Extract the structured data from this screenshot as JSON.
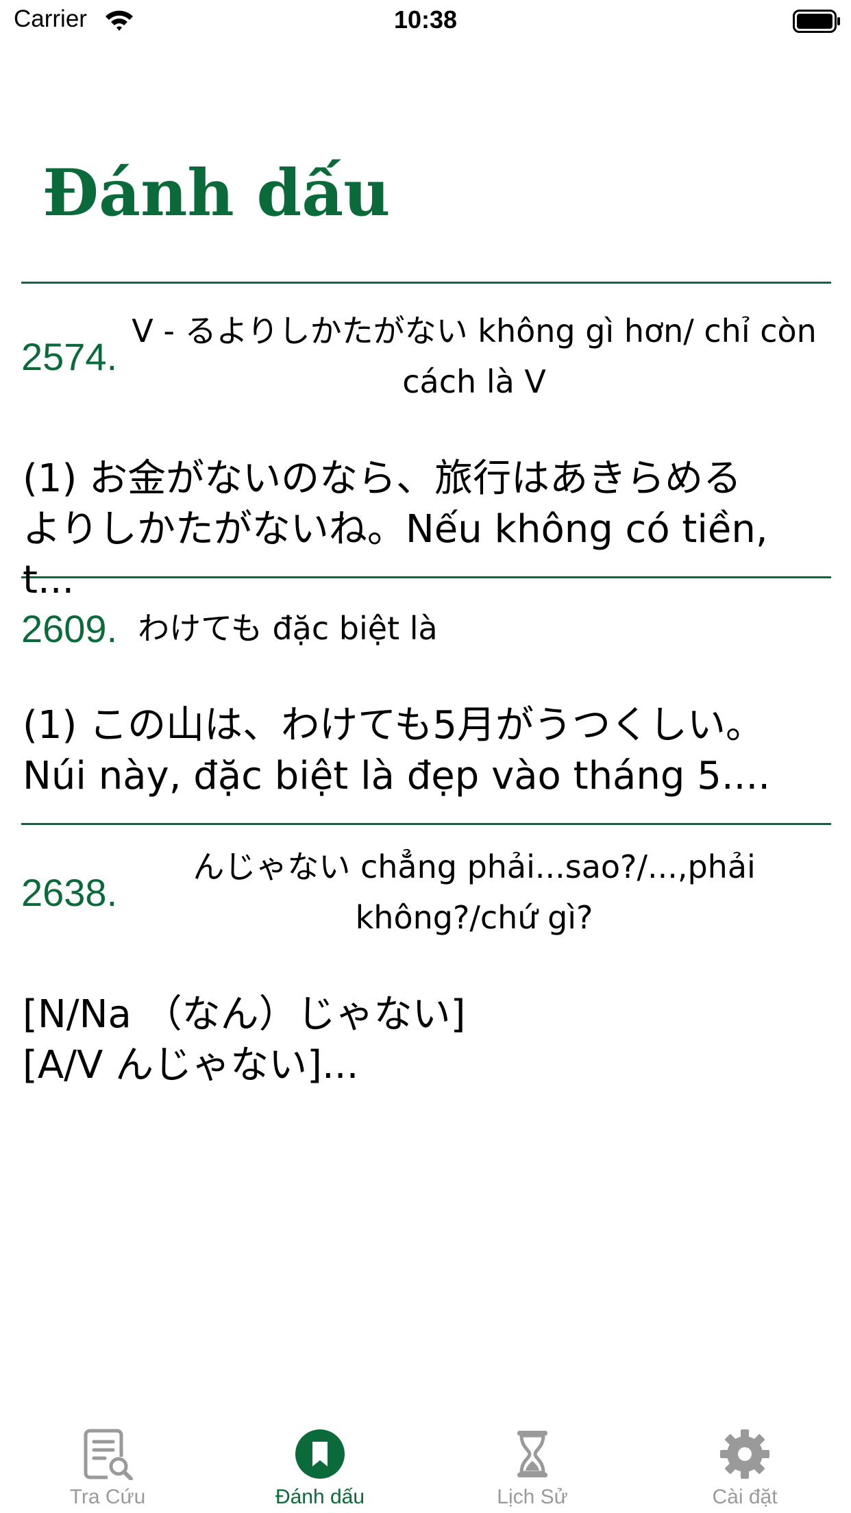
{
  "status_bar": {
    "carrier": "Carrier",
    "time": "10:38"
  },
  "page": {
    "title": "Đánh dấu"
  },
  "items": [
    {
      "number": "2574.",
      "title": "V - るよりしかたがない không gì hơn/ chỉ còn cách là V",
      "body": "(1) お金がないのなら、旅行はあきらめる\nよりしかたがないね。Nếu không có tiền, t..."
    },
    {
      "number": "2609.",
      "title": "わけても đặc biệt là",
      "body": "(1) この山は、わけても5月がうつくしい。\nNúi này, đặc biệt là đẹp vào tháng 5...."
    },
    {
      "number": "2638.",
      "title": "んじゃない chẳng phải...sao?/...,phải không?/chứ gì?",
      "body": "[N/Na （なん）じゃない]\n[A/V んじゃない]..."
    }
  ],
  "tabs": [
    {
      "label": "Tra Cứu",
      "icon": "document-search-icon"
    },
    {
      "label": "Đánh dấu",
      "icon": "bookmark-icon",
      "active": true
    },
    {
      "label": "Lịch Sử",
      "icon": "hourglass-icon"
    },
    {
      "label": "Cài đặt",
      "icon": "gear-icon"
    }
  ],
  "colors": {
    "accent": "#0b6a3a",
    "inactive": "#9a9a9a"
  }
}
